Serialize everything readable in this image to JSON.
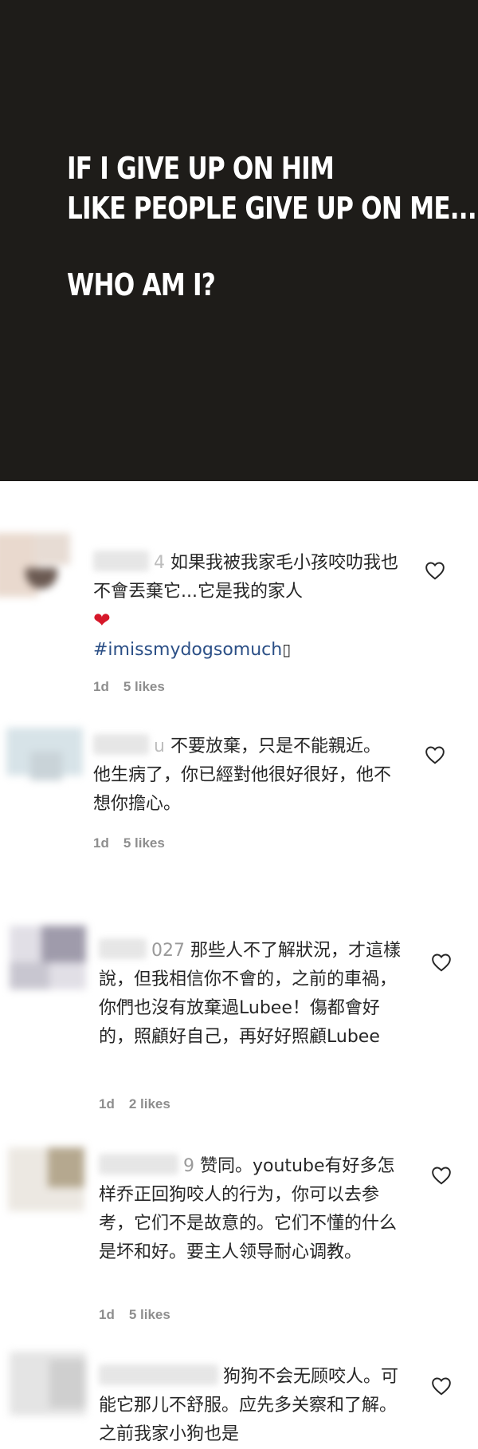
{
  "banner": {
    "line1": "IF I GIVE UP ON HIM",
    "line2": "LIKE PEOPLE GIVE UP ON ME....",
    "line3": "WHO AM I?",
    "bg_color": "#1e1c19"
  },
  "comments": [
    {
      "username_visible": "4",
      "text": "如果我被我家毛小孩咬叻我也不會丟棄它...它是我的家人",
      "emoji": "❤",
      "hashtag": "#imissmydogsomuch",
      "time": "1d",
      "likes": "5 likes"
    },
    {
      "username_visible": "u",
      "text": "不要放棄，只是不能親近。他生病了，你已經對他很好很好，他不想你擔心。",
      "time": "1d",
      "likes": "5 likes"
    },
    {
      "username_visible": "027",
      "text": "那些人不了解狀況，才這樣說，但我相信你不會的，之前的車禍，你們也沒有放棄過Lubee！傷都會好的，照顧好自己，再好好照顧Lubee",
      "time": "1d",
      "likes": "2 likes"
    },
    {
      "username_visible": "9",
      "text": "赞同。youtube有好多怎样乔正回狗咬人的行为，你可以去参考，它们不是故意的。它们不懂的什么是坏和好。要主人领导耐心调教。",
      "time": "1d",
      "likes": "5 likes"
    },
    {
      "username_visible": "",
      "text": "狗狗不会无顾咬人。可能它那儿不舒服。应先多关察和了解。之前我家小狗也是",
      "time": "",
      "likes": ""
    }
  ],
  "icons": {
    "like": "heart-outline-icon"
  }
}
